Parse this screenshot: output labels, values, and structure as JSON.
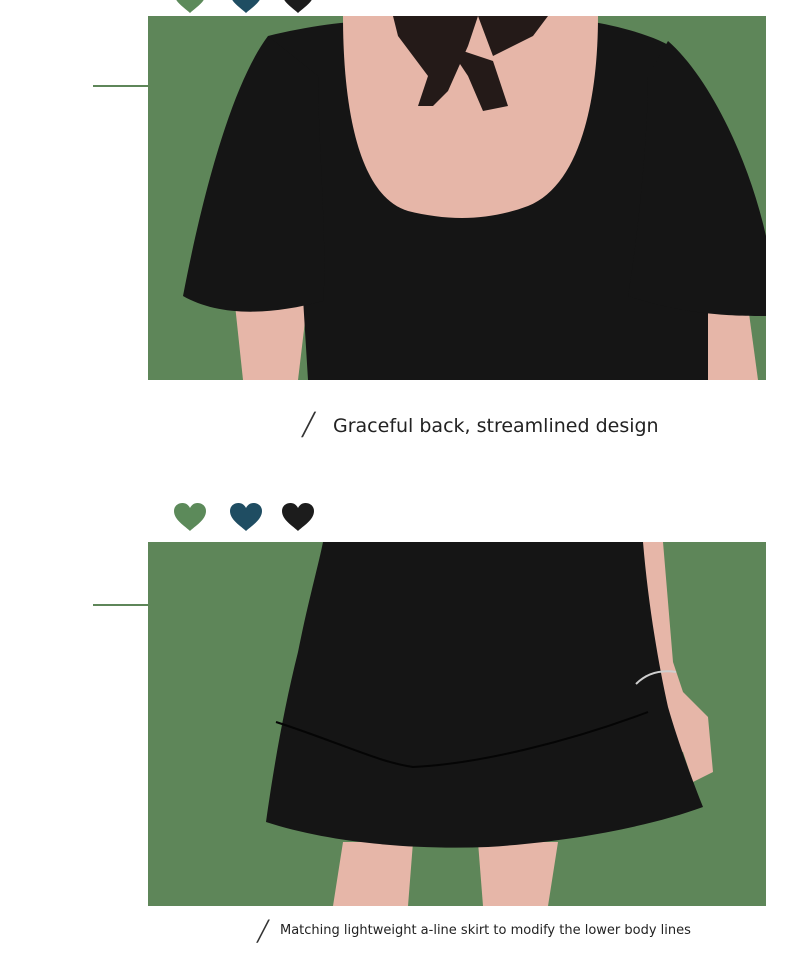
{
  "colors": {
    "background": "#ffffff",
    "panel_green": "#5e8659",
    "heart_green": "#5c8a5a",
    "heart_teal": "#1f4d62",
    "heart_black": "#1c1c1c",
    "line_green": "#5e8659",
    "garment": "#151515",
    "skin": "#e6b6a8"
  },
  "hearts": [
    {
      "name": "green-heart-icon",
      "color": "#5c8a5a"
    },
    {
      "name": "teal-heart-icon",
      "color": "#1f4d62"
    },
    {
      "name": "black-heart-icon",
      "color": "#1c1c1c"
    }
  ],
  "section1": {
    "caption": "Graceful back, streamlined design",
    "divider": "╱"
  },
  "section2": {
    "caption": "Matching lightweight a-line skirt to modify the lower body lines",
    "divider": "╱"
  }
}
